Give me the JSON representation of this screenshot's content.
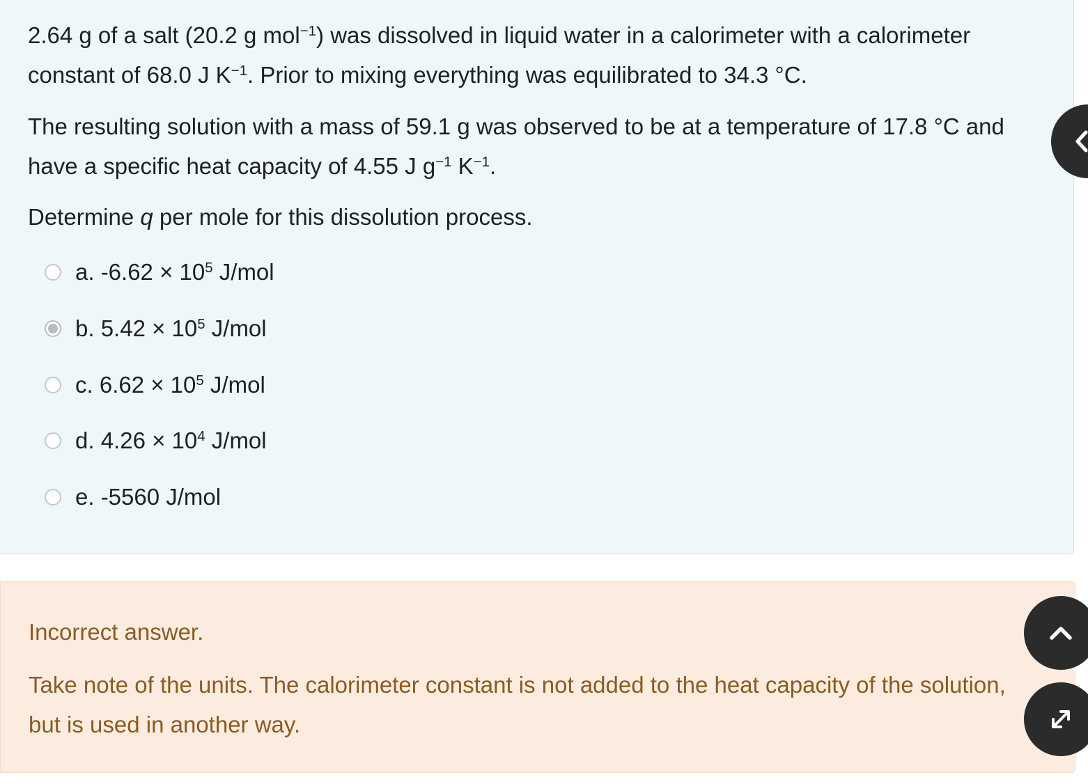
{
  "question": {
    "p1": {
      "part1": "2.64 g of a salt (20.2 g mol",
      "sup1": "−1",
      "part2": ") was dissolved in liquid water in a calorimeter with a calorimeter constant of 68.0 J K",
      "sup2": "−1",
      "part3": ". Prior to mixing everything was equilibrated to 34.3 °C."
    },
    "p2": {
      "part1": "The resulting solution with a mass of 59.1 g was observed to be at a temperature of 17.8 °C and have a specific heat capacity of 4.55 J g",
      "sup1": "−1",
      "part2": " K",
      "sup2": "−1",
      "part3": "."
    },
    "p3": {
      "part1": "Determine ",
      "q": "q",
      "part2": " per mole for this dissolution process."
    }
  },
  "answers": [
    {
      "prefix": "a. -6.62 × 10",
      "exp": "5",
      "suffix": " J/mol",
      "selected": false
    },
    {
      "prefix": "b. 5.42 × 10",
      "exp": "5",
      "suffix": " J/mol",
      "selected": true
    },
    {
      "prefix": "c. 6.62 × 10",
      "exp": "5",
      "suffix": " J/mol",
      "selected": false
    },
    {
      "prefix": "d. 4.26 × 10",
      "exp": "4",
      "suffix": " J/mol",
      "selected": false
    },
    {
      "prefix": "e. -5560 J/mol",
      "exp": "",
      "suffix": "",
      "selected": false
    }
  ],
  "feedback": {
    "title": "Incorrect answer.",
    "text": "Take note of the units. The calorimeter constant is not added to the heat capacity of the solution, but is used in another way."
  },
  "icons": {
    "drawer": "chevron-left-icon",
    "up": "chevron-up-icon",
    "expand": "expand-arrows-icon"
  },
  "colors": {
    "question_bg": "#eff7fb",
    "feedback_bg": "#fbecdf",
    "feedback_text": "#8a5b24",
    "fab_bg": "#2b2b2b"
  }
}
